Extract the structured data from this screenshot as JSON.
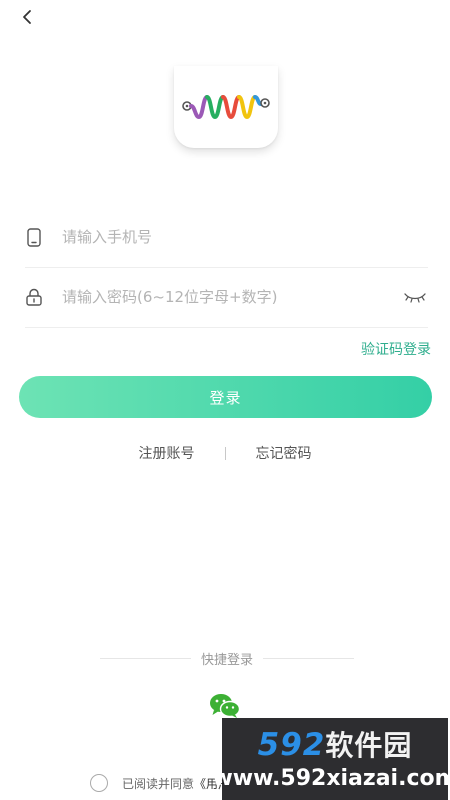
{
  "header": {
    "back_icon": "chevron-left-icon"
  },
  "logo": {
    "icon": "wave-logo-icon",
    "colors": [
      "#8e44ad",
      "#2ecc71",
      "#e74c3c",
      "#f1c40f",
      "#3498db"
    ]
  },
  "form": {
    "phone_icon": "phone-icon",
    "phone_value": "",
    "phone_placeholder": "请输入手机号",
    "password_icon": "lock-icon",
    "password_value": "",
    "password_placeholder": "请输入密码(6~12位字母+数字)",
    "toggle_icon": "eye-closed-icon"
  },
  "links": {
    "sms_login": "验证码登录",
    "register": "注册账号",
    "forgot_password": "忘记密码"
  },
  "login_button": {
    "label": "登录"
  },
  "quick_login": {
    "title": "快捷登录",
    "wechat_icon": "wechat-icon"
  },
  "agreement": {
    "prefix": "已阅读并同意",
    "terms": "《用户"
  },
  "watermark": {
    "number": "592",
    "brand": "软件园",
    "url": "www.592xiazai.com"
  },
  "colors": {
    "accent": "#34cfa6",
    "accent_light": "#6de3b4",
    "link": "#2fae8e"
  }
}
